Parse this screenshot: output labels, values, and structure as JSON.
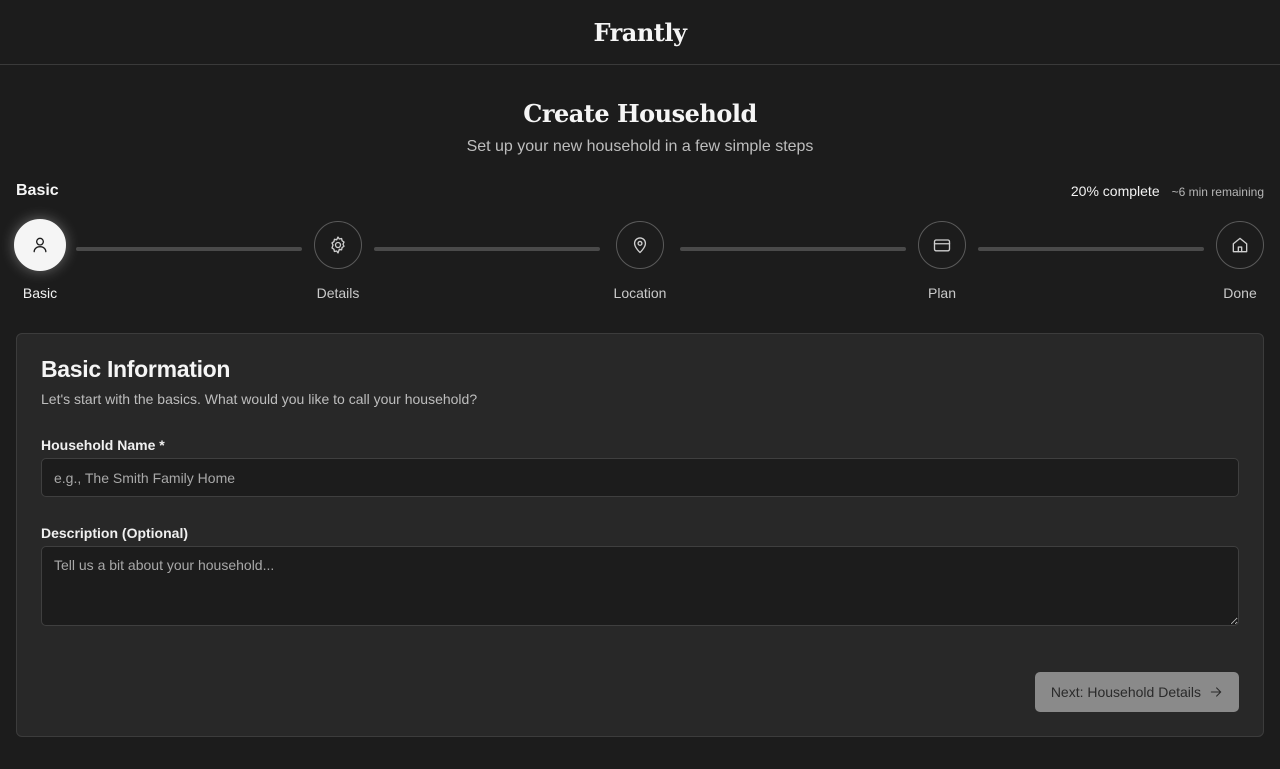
{
  "header": {
    "brand": "Frantly"
  },
  "page": {
    "title": "Create Household",
    "subtitle": "Set up your new household in a few simple steps"
  },
  "progress": {
    "current_step_label": "Basic",
    "percent_text": "20% complete",
    "percent": 20,
    "remaining_text": "~6 min remaining"
  },
  "steps": [
    {
      "label": "Basic",
      "icon": "user-icon",
      "active": true
    },
    {
      "label": "Details",
      "icon": "gear-icon",
      "active": false
    },
    {
      "label": "Location",
      "icon": "map-pin-icon",
      "active": false
    },
    {
      "label": "Plan",
      "icon": "credit-card-icon",
      "active": false
    },
    {
      "label": "Done",
      "icon": "home-icon",
      "active": false
    }
  ],
  "form": {
    "title": "Basic Information",
    "subtitle": "Let's start with the basics. What would you like to call your household?",
    "name_label": "Household Name *",
    "name_placeholder": "e.g., The Smith Family Home",
    "name_value": "",
    "description_label": "Description (Optional)",
    "description_placeholder": "Tell us a bit about your household...",
    "description_value": "",
    "next_label": "Next: Household Details"
  },
  "colors": {
    "background": "#1c1c1c",
    "card": "#282828",
    "active_step": "#f5f5f5",
    "button_disabled": "#8a8a8a"
  }
}
